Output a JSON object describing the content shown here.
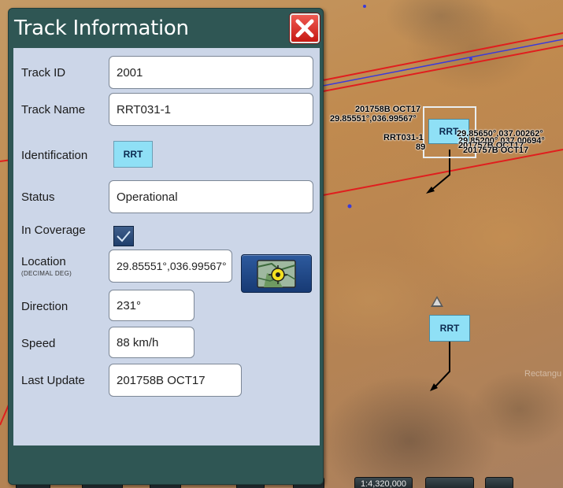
{
  "panel": {
    "title": "Track Information",
    "fields": {
      "track_id": {
        "label": "Track ID",
        "value": "2001"
      },
      "track_name": {
        "label": "Track Name",
        "value": "RRT031-1"
      },
      "identification": {
        "label": "Identification",
        "value": "RRT"
      },
      "status": {
        "label": "Status",
        "value": "Operational"
      },
      "in_coverage": {
        "label": "In Coverage",
        "checked": true
      },
      "location": {
        "label": "Location",
        "sublabel": "(DECIMAL DEG)",
        "value": "29.85551°,036.99567°"
      },
      "direction": {
        "label": "Direction",
        "value": "231°"
      },
      "speed": {
        "label": "Speed",
        "value": "88 km/h"
      },
      "last_update": {
        "label": "Last Update",
        "value": "201758B OCT17"
      }
    }
  },
  "map": {
    "track_symbol_text": "RRT",
    "labels": {
      "selected_time": "201758B OCT17",
      "selected_coords": "29.85551°,036.99567°",
      "selected_name": "RRT031-1",
      "selected_partial": "89",
      "overlap_1": "29.85650°,037.00262°",
      "overlap_2": "29.85200°,037.00694°",
      "overlap_3": "201757B OCT17",
      "overlap_4": "201757B OCT17",
      "faint_label": "Rectangu"
    },
    "toolbar_scale": "1:4,320,000"
  },
  "colors": {
    "panel_header": "#2f5654",
    "panel_body": "#ccd6e8",
    "track_fill": "#8fe0f6",
    "route_line": "#e01e1e"
  }
}
